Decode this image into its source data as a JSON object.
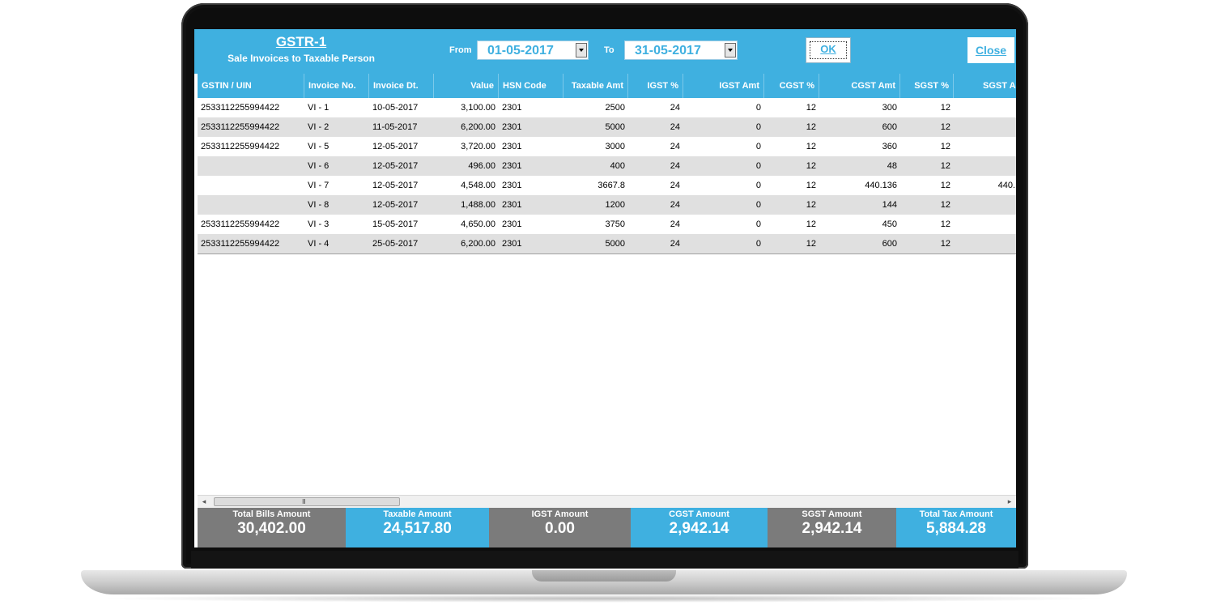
{
  "header": {
    "title": "GSTR-1",
    "subtitle": "Sale Invoices to Taxable Person",
    "from_label": "From",
    "from_date": "01-05-2017",
    "to_label": "To",
    "to_date": "31-05-2017",
    "ok_label": "OK",
    "close_label": "Close"
  },
  "table": {
    "columns": [
      "GSTIN / UIN",
      "Invoice No.",
      "Invoice Dt.",
      "Value",
      "HSN Code",
      "Taxable Amt",
      "IGST %",
      "IGST Amt",
      "CGST %",
      "CGST Amt",
      "SGST %",
      "SGST Amt"
    ],
    "rows": [
      [
        "2533112255994422",
        "VI - 1",
        "10-05-2017",
        "3,100.00",
        "2301",
        "2500",
        "24",
        "0",
        "12",
        "300",
        "12",
        ""
      ],
      [
        "2533112255994422",
        "VI - 2",
        "11-05-2017",
        "6,200.00",
        "2301",
        "5000",
        "24",
        "0",
        "12",
        "600",
        "12",
        ""
      ],
      [
        "2533112255994422",
        "VI - 5",
        "12-05-2017",
        "3,720.00",
        "2301",
        "3000",
        "24",
        "0",
        "12",
        "360",
        "12",
        ""
      ],
      [
        "",
        "VI - 6",
        "12-05-2017",
        "496.00",
        "2301",
        "400",
        "24",
        "0",
        "12",
        "48",
        "12",
        ""
      ],
      [
        "",
        "VI - 7",
        "12-05-2017",
        "4,548.00",
        "2301",
        "3667.8",
        "24",
        "0",
        "12",
        "440.136",
        "12",
        "440."
      ],
      [
        "",
        "VI - 8",
        "12-05-2017",
        "1,488.00",
        "2301",
        "1200",
        "24",
        "0",
        "12",
        "144",
        "12",
        ""
      ],
      [
        "2533112255994422",
        "VI - 3",
        "15-05-2017",
        "4,650.00",
        "2301",
        "3750",
        "24",
        "0",
        "12",
        "450",
        "12",
        ""
      ],
      [
        "2533112255994422",
        "VI - 4",
        "25-05-2017",
        "6,200.00",
        "2301",
        "5000",
        "24",
        "0",
        "12",
        "600",
        "12",
        ""
      ]
    ]
  },
  "scrollbar": {
    "grip": "III"
  },
  "totals": [
    {
      "label": "Total Bills Amount",
      "value": "30,402.00"
    },
    {
      "label": "Taxable Amount",
      "value": "24,517.80"
    },
    {
      "label": "IGST Amount",
      "value": "0.00"
    },
    {
      "label": "CGST Amount",
      "value": "2,942.14"
    },
    {
      "label": "SGST Amount",
      "value": "2,942.14"
    },
    {
      "label": "Total Tax Amount",
      "value": "5,884.28"
    }
  ],
  "colors": {
    "accent": "#3fb0e0",
    "totals_gray": "#7b7b7b",
    "alt_row": "#e0e0e0"
  },
  "icons": {
    "dropdown": "chevron-down-icon",
    "scroll_left": "scroll-left-arrow-icon",
    "scroll_right": "scroll-right-arrow-icon"
  }
}
